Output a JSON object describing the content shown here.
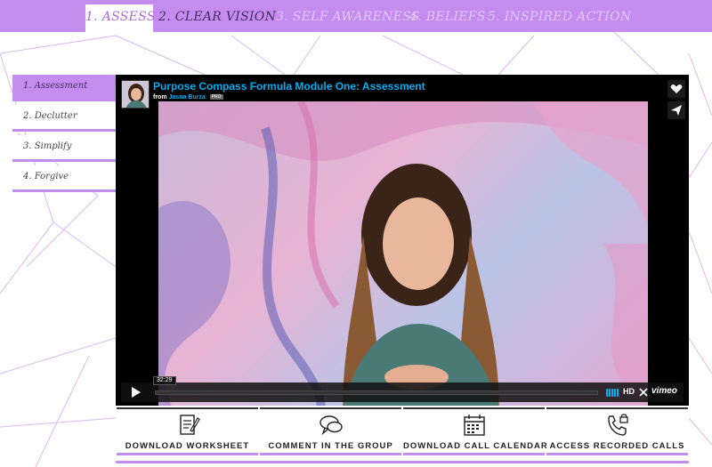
{
  "nav": {
    "tabs": [
      {
        "label": "1. ASSESS",
        "state": "active"
      },
      {
        "label": "2. CLEAR VISION",
        "state": "done"
      },
      {
        "label": "3. SELF AWARENESS",
        "state": "locked"
      },
      {
        "label": "4. BELIEFS",
        "state": "locked"
      },
      {
        "label": "5. INSPIRED ACTION",
        "state": "locked"
      }
    ]
  },
  "sidebar": {
    "items": [
      {
        "label": "1. Assessment",
        "active": true
      },
      {
        "label": "2. Declutter",
        "active": false
      },
      {
        "label": "3. Simplify",
        "active": false
      },
      {
        "label": "4. Forgive",
        "active": false
      }
    ]
  },
  "video": {
    "title": "Purpose Compass Formula Module One: Assessment",
    "from_label": "from",
    "author": "Jasna Burza",
    "badge": "PRO",
    "duration": "32:29",
    "progress": 0,
    "hd_label": "HD",
    "brand": "vimeo",
    "icons": [
      "heart-icon",
      "send-icon",
      "play-icon",
      "volume-icon",
      "fullscreen-icon"
    ]
  },
  "actions": [
    {
      "label": "DOWNLOAD WORKSHEET",
      "icon": "worksheet-icon"
    },
    {
      "label": "COMMENT IN THE GROUP",
      "icon": "comment-icon"
    },
    {
      "label": "DOWNLOAD CALL CALENDAR",
      "icon": "calendar-icon"
    },
    {
      "label": "ACCESS RECORDED CALLS",
      "icon": "phone-lock-icon"
    }
  ],
  "colors": {
    "accent": "#c58cf0",
    "accent_dark": "#4a2a66",
    "vimeo_blue": "#00adef",
    "player_bg": "#000000"
  }
}
